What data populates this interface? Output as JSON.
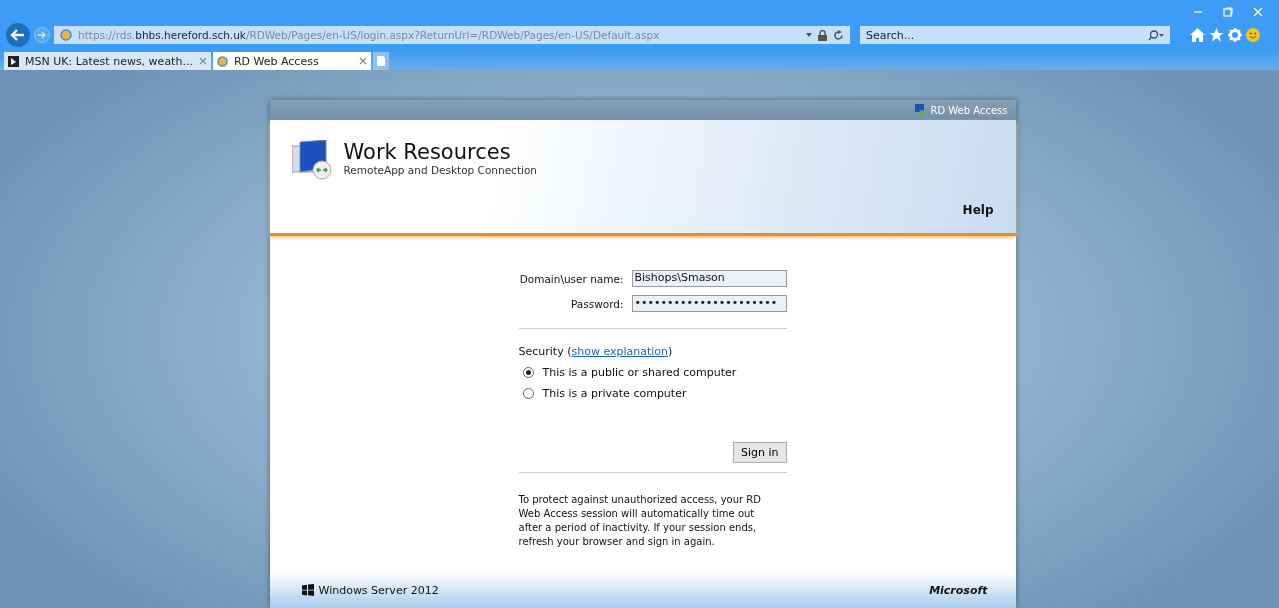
{
  "browser": {
    "address": "https://rds.**bhbs.hereford.sch.uk**/RDWeb/Pages/en-US/login.aspx?ReturnUrl=/RDWeb/Pages/en-US/Default.aspx",
    "search": {
      "placeholder": "Search..."
    },
    "tabs": [
      {
        "label": "MSN UK: Latest news, weath...",
        "selected": false
      },
      {
        "label": "RD Web Access",
        "selected": true
      }
    ]
  },
  "page": {
    "top_bar_label": "RD Web Access",
    "title": "Work Resources",
    "subtitle": "RemoteApp and Desktop Connection",
    "help": "Help",
    "form": {
      "fields": [
        {
          "label": "Domain\\user name:",
          "value": "Bishops\\Smason"
        },
        {
          "label": "Password:",
          "value": "••••••••••••••••••••••"
        }
      ],
      "security_label": "Security (",
      "security_link": "show explanation",
      "security_end": ")",
      "options": [
        {
          "label": "This is a public or shared computer",
          "selected": true
        },
        {
          "label": "This is a private computer",
          "selected": false
        }
      ],
      "sign_in": "Sign in",
      "notice": "To protect against unauthorized access, your RD Web Access session will automatically time out after a period of inactivity. If your session ends, refresh your browser and sign in again."
    },
    "footer_left": "Windows Server 2012",
    "footer_right": "Microsoft"
  }
}
